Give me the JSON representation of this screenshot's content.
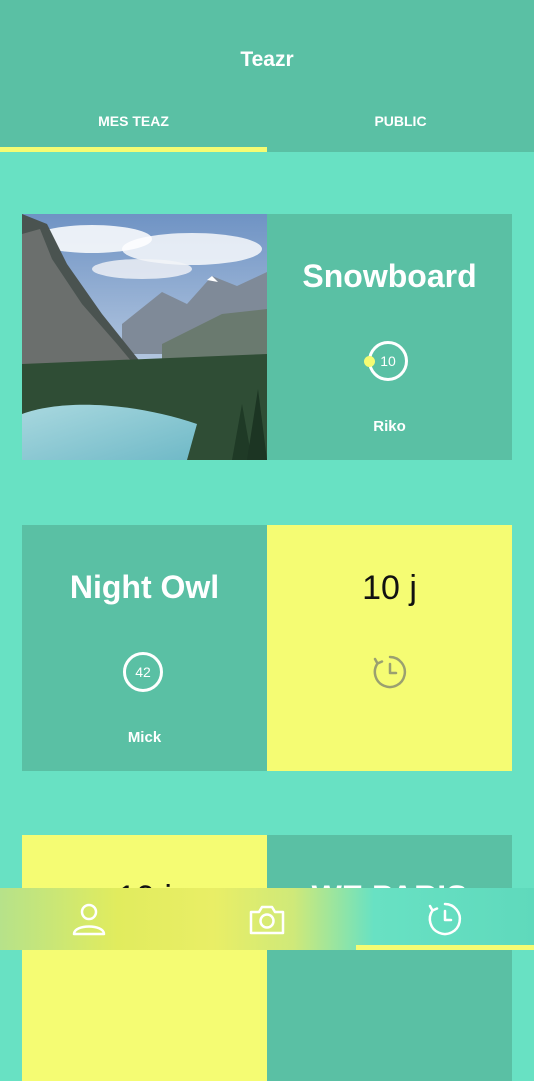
{
  "app": {
    "title": "Teazr"
  },
  "tabs": [
    {
      "label": "MES TEAZ",
      "active": true
    },
    {
      "label": "PUBLIC",
      "active": false
    }
  ],
  "cards": [
    {
      "title": "Snowboard",
      "count": "10",
      "author": "Riko",
      "image": "mountain-lake-photo"
    },
    {
      "title": "Night Owl",
      "count": "42",
      "author": "Mick",
      "time_left": "10 j"
    },
    {
      "left_text": "10 j",
      "right_text": "WE PARIS"
    }
  ],
  "bottom_nav": [
    {
      "name": "profile",
      "icon": "person-icon"
    },
    {
      "name": "camera",
      "icon": "camera-icon"
    },
    {
      "name": "timer",
      "icon": "timer-icon",
      "active": true
    }
  ],
  "colors": {
    "background": "#68e1c3",
    "header": "#5ac0a4",
    "card_teal": "#5ac0a4",
    "accent_yellow": "#f5fc73"
  }
}
